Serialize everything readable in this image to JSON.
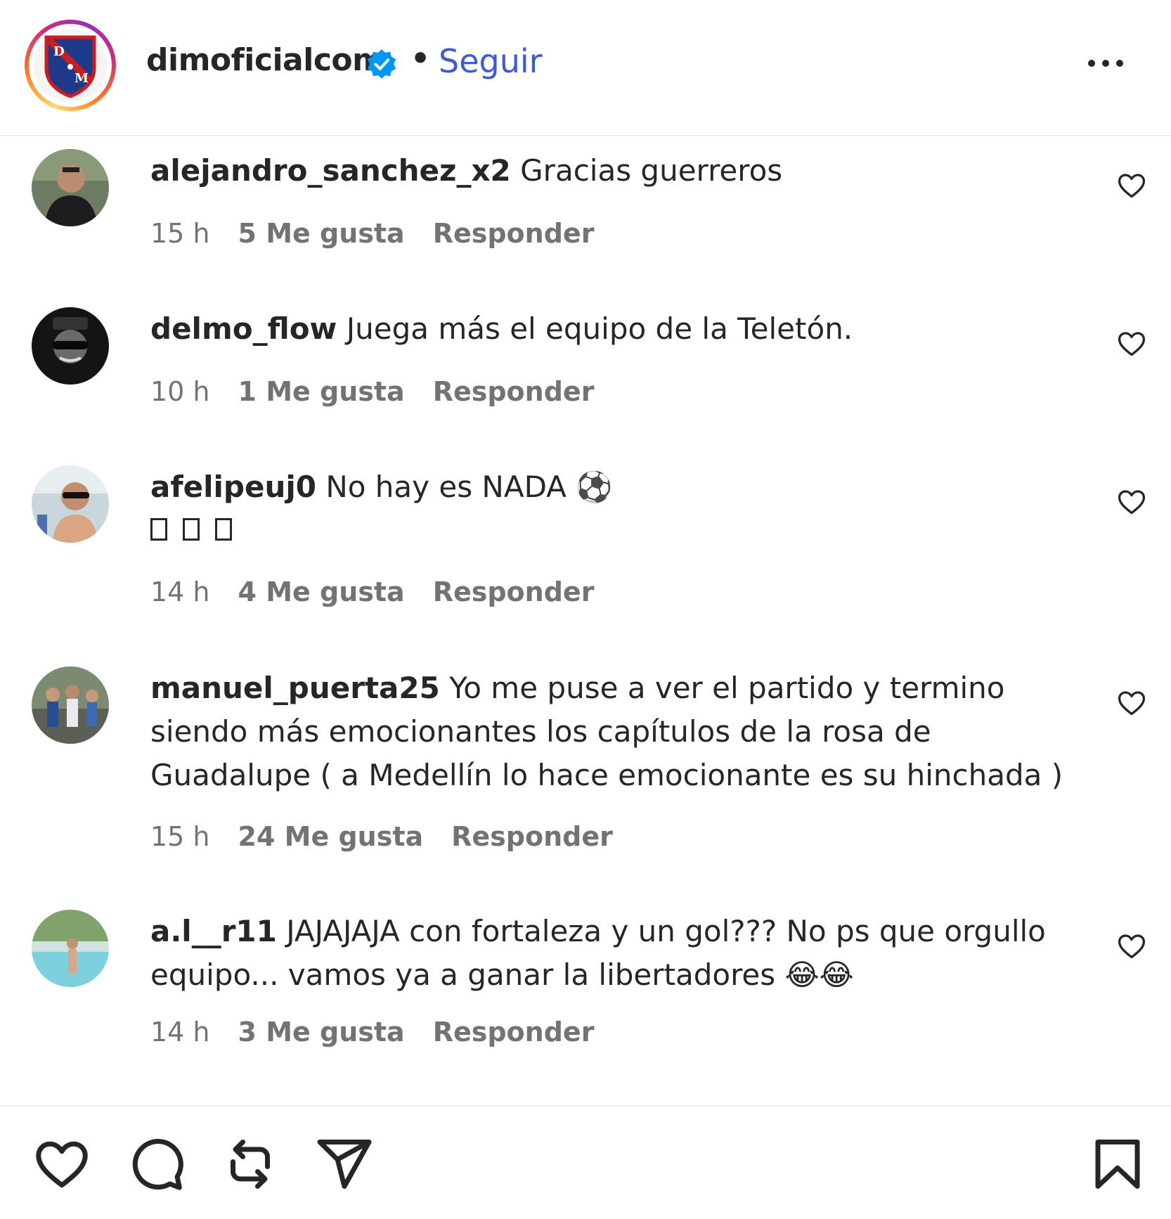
{
  "header": {
    "username": "dimoficialcom",
    "separator": "•",
    "follow_label": "Seguir",
    "verified_icon": "verified-badge-icon",
    "more_icon": "more-options-icon"
  },
  "comments": [
    {
      "username": "alejandro_sanchez_x2",
      "text": "Gracias guerreros",
      "time": "15 h",
      "likes": "5 Me gusta",
      "reply": "Responder"
    },
    {
      "username": "delmo_flow",
      "text": "Juega más el equipo de la Teletón.",
      "time": "10 h",
      "likes": "1 Me gusta",
      "reply": "Responder"
    },
    {
      "username": "afelipeuj0",
      "text": "No hay es NADA ⚽",
      "time": "14 h",
      "likes": "4 Me gusta",
      "reply": "Responder"
    },
    {
      "username": "manuel_puerta25",
      "text": "Yo me puse a ver el partido y termino siendo más emocionantes los capítulos de la rosa de Guadalupe ( a Medellín lo hace emocionante es su hinchada )",
      "time": "15 h",
      "likes": "24 Me gusta",
      "reply": "Responder"
    },
    {
      "username": "a.l__r11",
      "text": "JAJAJAJA con fortaleza y un gol??? No ps que orgullo equipo... vamos ya a ganar la libertadores 😂😂",
      "time": "14 h",
      "likes": "3 Me gusta",
      "reply": "Responder"
    }
  ],
  "footer": {
    "icons": [
      "like-icon",
      "comment-icon",
      "repost-icon",
      "share-icon",
      "save-icon"
    ]
  },
  "colors": {
    "follow": "#3b5bdb",
    "verified": "#0095f6",
    "text": "#262626",
    "meta": "#737373"
  }
}
